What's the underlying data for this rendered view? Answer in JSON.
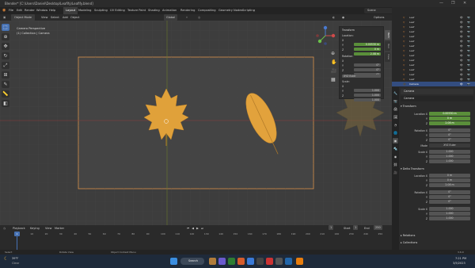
{
  "window": {
    "title": "Blender* [C:\\Users\\Daniel\\Desktop\\Leafify\\Leafify.blend]",
    "controls": [
      "—",
      "❐",
      "✕"
    ]
  },
  "menu": {
    "items": [
      "File",
      "Edit",
      "Render",
      "Window",
      "Help"
    ],
    "workspaces": [
      "Layout",
      "Modeling",
      "Sculpting",
      "UV Editing",
      "Texture Paint",
      "Shading",
      "Animation",
      "Rendering",
      "Compositing",
      "Geometry Nodes",
      "Scripting"
    ],
    "active_workspace": "Layout",
    "scene": "Scene",
    "view_layer": "ViewLayer"
  },
  "viewport_header": {
    "mode": "Object Mode",
    "menus": [
      "View",
      "Select",
      "Add",
      "Object"
    ],
    "orientation": "Global",
    "options": "Options"
  },
  "viewport": {
    "overlay_line1": "Camera Perspective",
    "overlay_line2": "(1) Collection | Camera"
  },
  "npanel": {
    "transform_title": "Transform",
    "location_label": "Location:",
    "location": [
      "0.00530 m",
      "0 m",
      "2.08 m"
    ],
    "rotation_label": "Rotation:",
    "rotation": [
      "0°",
      "0°",
      "0°"
    ],
    "rotation_mode": "XYZ Euler",
    "scale_label": "Scale:",
    "scale": [
      "1.000",
      "1.000",
      "1.000"
    ],
    "axes": [
      "X",
      "Y",
      "Z"
    ],
    "tabs": [
      "Item",
      "Tool",
      "View"
    ]
  },
  "outliner": {
    "rows": [
      "Leaf",
      "Leaf",
      "Leaf",
      "Leaf",
      "Leaf",
      "Leaf",
      "Leaf",
      "Leaf",
      "Leaf",
      "Leaf",
      "Leaf",
      "Leaf",
      "Leaf",
      "Leaf",
      "Camera"
    ],
    "selected": "Camera"
  },
  "properties": {
    "object_name": "Camera",
    "data_name": "Camera",
    "transform": "Transform",
    "location_label": "Location X",
    "location": [
      "0.00530 m",
      "0 m",
      "2.08 m"
    ],
    "rotation_label": "Rotation X",
    "rotation": [
      "0°",
      "0°",
      "0°"
    ],
    "mode_label": "Mode",
    "mode": "XYZ Euler",
    "scale_label": "Scale X",
    "scale": [
      "1.000",
      "1.000",
      "1.000"
    ],
    "delta": "Delta Transform",
    "delta_location": [
      "0 m",
      "0 m",
      "2.08 m"
    ],
    "delta_rotation": [
      "0°",
      "0°",
      "0°"
    ],
    "delta_scale": [
      "1.000",
      "1.000",
      "1.000"
    ],
    "relations": "Relations",
    "collections": "Collections",
    "axis_y": "Y",
    "axis_z": "Z"
  },
  "timeline": {
    "menus": [
      "Playback",
      "Keying",
      "View",
      "Marker"
    ],
    "current_frame": "1",
    "start_label": "Start",
    "start": "1",
    "end_label": "End",
    "end": "250",
    "ticks": [
      "1",
      "10",
      "20",
      "30",
      "40",
      "50",
      "60",
      "70",
      "80",
      "90",
      "100",
      "110",
      "120",
      "130",
      "140",
      "150",
      "160",
      "170",
      "180",
      "190",
      "200",
      "210",
      "220",
      "230",
      "240",
      "250"
    ]
  },
  "statusbar": {
    "select": "Select",
    "rotate": "Rotate View",
    "context": "Object Context Menu",
    "version": "3.6.0"
  },
  "taskbar": {
    "weather_temp": "39°F",
    "weather_desc": "Clear",
    "search": "Search",
    "time": "7:21 PM",
    "date": "3/5/2023"
  },
  "colors": {
    "accent": "#4772b3",
    "selected_row": "#334d80",
    "field_green": "#5a8f3a",
    "camera_frame": "#d9924a",
    "leaf_orange": "#e0a13a"
  }
}
